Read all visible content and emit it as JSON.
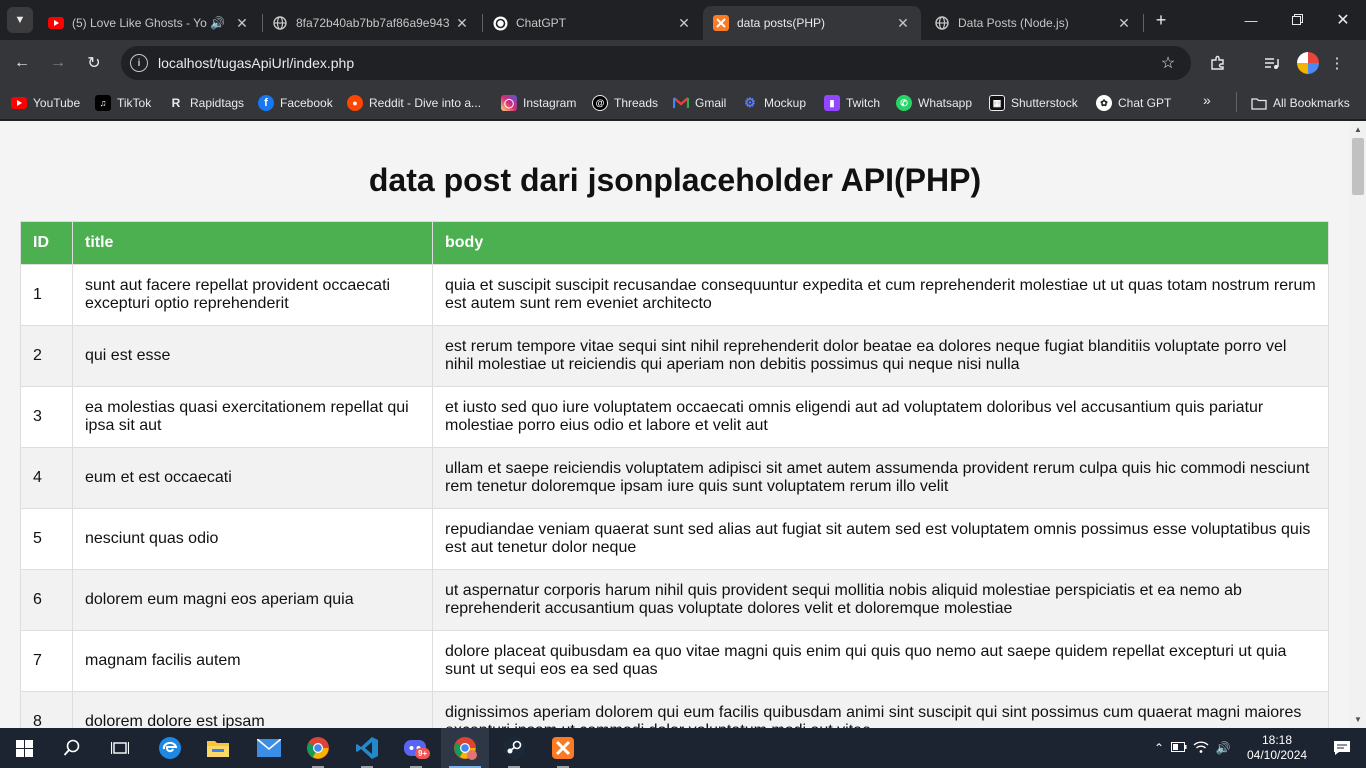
{
  "browser": {
    "tabs": [
      {
        "title": "(5) Love Like Ghosts - Yo",
        "icon": "youtube-icon",
        "audio": true,
        "active": false
      },
      {
        "title": "8fa72b40ab7bb7af86a9e943",
        "icon": "globe-icon",
        "audio": false,
        "active": false
      },
      {
        "title": "ChatGPT",
        "icon": "chatgpt-icon",
        "audio": false,
        "active": false
      },
      {
        "title": "data posts(PHP)",
        "icon": "xampp-icon",
        "audio": false,
        "active": true
      },
      {
        "title": "Data Posts (Node.js)",
        "icon": "globe-icon",
        "audio": false,
        "active": false
      }
    ],
    "url": "localhost/tugasApiUrl/index.php",
    "bookmarks": [
      {
        "label": "YouTube",
        "icon": "youtube-icon",
        "color": "#ff0000"
      },
      {
        "label": "TikTok",
        "icon": "tiktok-icon",
        "color": "#000000"
      },
      {
        "label": "Rapidtags",
        "icon": "rapidtags-icon",
        "color": "#111111"
      },
      {
        "label": "Facebook",
        "icon": "facebook-icon",
        "color": "#1877f2"
      },
      {
        "label": "Reddit - Dive into a...",
        "icon": "reddit-icon",
        "color": "#ff4500"
      },
      {
        "label": "Instagram",
        "icon": "instagram-icon",
        "color": "#d62976"
      },
      {
        "label": "Threads",
        "icon": "threads-icon",
        "color": "#000000"
      },
      {
        "label": "Gmail",
        "icon": "gmail-icon",
        "color": "#ea4335"
      },
      {
        "label": "Mockup",
        "icon": "mockup-icon",
        "color": "#3b5bdb"
      },
      {
        "label": "Twitch",
        "icon": "twitch-icon",
        "color": "#9146ff"
      },
      {
        "label": "Whatsapp",
        "icon": "whatsapp-icon",
        "color": "#25d366"
      },
      {
        "label": "Shutterstock",
        "icon": "shutterstock-icon",
        "color": "#111111"
      },
      {
        "label": "Chat GPT",
        "icon": "chatgpt-icon",
        "color": "#ffffff"
      }
    ],
    "all_bookmarks_label": "All Bookmarks"
  },
  "page": {
    "heading": "data post dari jsonplaceholder API(PHP)",
    "columns": [
      "ID",
      "title",
      "body"
    ],
    "rows": [
      {
        "id": "1",
        "title": "sunt aut facere repellat provident occaecati excepturi optio reprehenderit",
        "body": "quia et suscipit suscipit recusandae consequuntur expedita et cum reprehenderit molestiae ut ut quas totam nostrum rerum est autem sunt rem eveniet architecto"
      },
      {
        "id": "2",
        "title": "qui est esse",
        "body": "est rerum tempore vitae sequi sint nihil reprehenderit dolor beatae ea dolores neque fugiat blanditiis voluptate porro vel nihil molestiae ut reiciendis qui aperiam non debitis possimus qui neque nisi nulla"
      },
      {
        "id": "3",
        "title": "ea molestias quasi exercitationem repellat qui ipsa sit aut",
        "body": "et iusto sed quo iure voluptatem occaecati omnis eligendi aut ad voluptatem doloribus vel accusantium quis pariatur molestiae porro eius odio et labore et velit aut"
      },
      {
        "id": "4",
        "title": "eum et est occaecati",
        "body": "ullam et saepe reiciendis voluptatem adipisci sit amet autem assumenda provident rerum culpa quis hic commodi nesciunt rem tenetur doloremque ipsam iure quis sunt voluptatem rerum illo velit"
      },
      {
        "id": "5",
        "title": "nesciunt quas odio",
        "body": "repudiandae veniam quaerat sunt sed alias aut fugiat sit autem sed est voluptatem omnis possimus esse voluptatibus quis est aut tenetur dolor neque"
      },
      {
        "id": "6",
        "title": "dolorem eum magni eos aperiam quia",
        "body": "ut aspernatur corporis harum nihil quis provident sequi mollitia nobis aliquid molestiae perspiciatis et ea nemo ab reprehenderit accusantium quas voluptate dolores velit et doloremque molestiae"
      },
      {
        "id": "7",
        "title": "magnam facilis autem",
        "body": "dolore placeat quibusdam ea quo vitae magni quis enim qui quis quo nemo aut saepe quidem repellat excepturi ut quia sunt ut sequi eos ea sed quas"
      },
      {
        "id": "8",
        "title": "dolorem dolore est ipsam",
        "body": "dignissimos aperiam dolorem qui eum facilis quibusdam animi sint suscipit qui sint possimus cum quaerat magni maiores excepturi ipsam ut commodi dolor voluptatum modi aut vitae"
      }
    ]
  },
  "taskbar": {
    "apps": [
      "start-icon",
      "search-icon",
      "task-view-icon",
      "edge-icon",
      "file-explorer-icon",
      "mail-icon",
      "chrome-icon",
      "vscode-icon",
      "discord-icon",
      "chrome-profile-icon",
      "steam-icon",
      "xampp-icon"
    ],
    "discord_badge": "9+",
    "time": "18:18",
    "date": "04/10/2024"
  },
  "colors": {
    "table_header": "#4caf50",
    "browser_frame": "#202124",
    "toolbar": "#35363a",
    "taskbar": "#1c2431"
  }
}
